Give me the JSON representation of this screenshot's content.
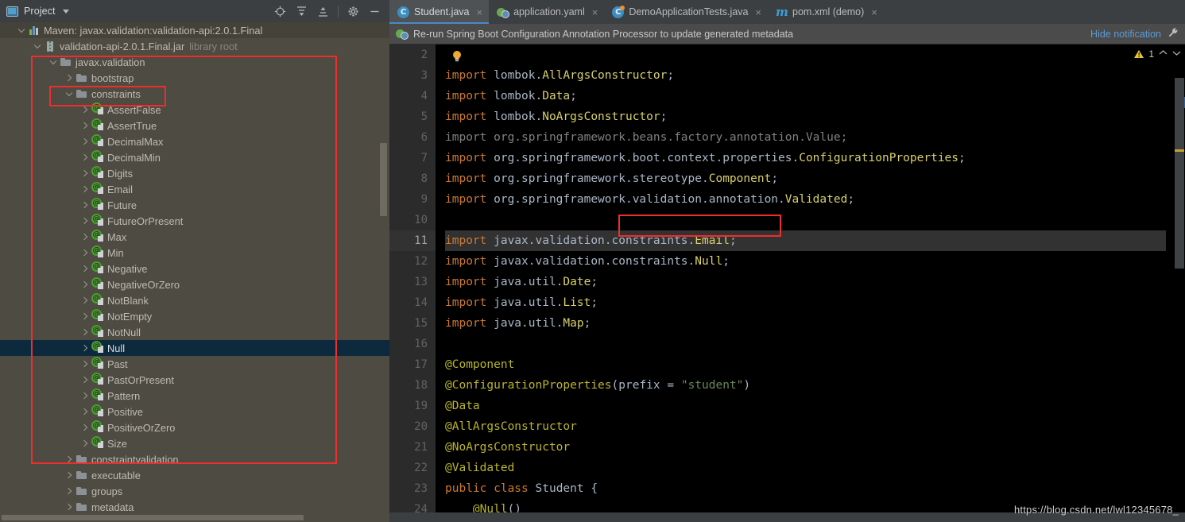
{
  "project_panel": {
    "title": "Project",
    "icons": {
      "locate": "locate-icon",
      "expand_all": "expand-all-icon",
      "collapse_all": "collapse-all-icon",
      "settings": "gear-icon",
      "minimize": "minimize-icon"
    },
    "tree": [
      {
        "label": "Maven: javax.validation:validation-api:2.0.1.Final",
        "suffix": "",
        "indent": 20,
        "icon": "maven-icon",
        "chevron": "open",
        "state": "hover"
      },
      {
        "label": "validation-api-2.0.1.Final.jar",
        "suffix": "library root",
        "indent": 40,
        "icon": "jar-icon",
        "chevron": "open",
        "state": "normal"
      },
      {
        "label": "javax.validation",
        "suffix": "",
        "indent": 60,
        "icon": "folder-icon",
        "chevron": "open",
        "state": "normal"
      },
      {
        "label": "bootstrap",
        "suffix": "",
        "indent": 80,
        "icon": "folder-icon",
        "chevron": "closed",
        "state": "normal"
      },
      {
        "label": "constraints",
        "suffix": "",
        "indent": 80,
        "icon": "folder-icon",
        "chevron": "open",
        "state": "normal"
      },
      {
        "label": "AssertFalse",
        "suffix": "",
        "indent": 100,
        "icon": "annotation-icon",
        "chevron": "closed",
        "state": "normal"
      },
      {
        "label": "AssertTrue",
        "suffix": "",
        "indent": 100,
        "icon": "annotation-icon",
        "chevron": "closed",
        "state": "normal"
      },
      {
        "label": "DecimalMax",
        "suffix": "",
        "indent": 100,
        "icon": "annotation-icon",
        "chevron": "closed",
        "state": "normal"
      },
      {
        "label": "DecimalMin",
        "suffix": "",
        "indent": 100,
        "icon": "annotation-icon",
        "chevron": "closed",
        "state": "normal"
      },
      {
        "label": "Digits",
        "suffix": "",
        "indent": 100,
        "icon": "annotation-icon",
        "chevron": "closed",
        "state": "normal"
      },
      {
        "label": "Email",
        "suffix": "",
        "indent": 100,
        "icon": "annotation-icon",
        "chevron": "closed",
        "state": "normal"
      },
      {
        "label": "Future",
        "suffix": "",
        "indent": 100,
        "icon": "annotation-icon",
        "chevron": "closed",
        "state": "normal"
      },
      {
        "label": "FutureOrPresent",
        "suffix": "",
        "indent": 100,
        "icon": "annotation-icon",
        "chevron": "closed",
        "state": "normal"
      },
      {
        "label": "Max",
        "suffix": "",
        "indent": 100,
        "icon": "annotation-icon",
        "chevron": "closed",
        "state": "normal"
      },
      {
        "label": "Min",
        "suffix": "",
        "indent": 100,
        "icon": "annotation-icon",
        "chevron": "closed",
        "state": "normal"
      },
      {
        "label": "Negative",
        "suffix": "",
        "indent": 100,
        "icon": "annotation-icon",
        "chevron": "closed",
        "state": "normal"
      },
      {
        "label": "NegativeOrZero",
        "suffix": "",
        "indent": 100,
        "icon": "annotation-icon",
        "chevron": "closed",
        "state": "normal"
      },
      {
        "label": "NotBlank",
        "suffix": "",
        "indent": 100,
        "icon": "annotation-icon",
        "chevron": "closed",
        "state": "normal"
      },
      {
        "label": "NotEmpty",
        "suffix": "",
        "indent": 100,
        "icon": "annotation-icon",
        "chevron": "closed",
        "state": "normal"
      },
      {
        "label": "NotNull",
        "suffix": "",
        "indent": 100,
        "icon": "annotation-icon",
        "chevron": "closed",
        "state": "normal"
      },
      {
        "label": "Null",
        "suffix": "",
        "indent": 100,
        "icon": "annotation-icon",
        "chevron": "closed",
        "state": "selected"
      },
      {
        "label": "Past",
        "suffix": "",
        "indent": 100,
        "icon": "annotation-icon",
        "chevron": "closed",
        "state": "normal"
      },
      {
        "label": "PastOrPresent",
        "suffix": "",
        "indent": 100,
        "icon": "annotation-icon",
        "chevron": "closed",
        "state": "normal"
      },
      {
        "label": "Pattern",
        "suffix": "",
        "indent": 100,
        "icon": "annotation-icon",
        "chevron": "closed",
        "state": "normal"
      },
      {
        "label": "Positive",
        "suffix": "",
        "indent": 100,
        "icon": "annotation-icon",
        "chevron": "closed",
        "state": "normal"
      },
      {
        "label": "PositiveOrZero",
        "suffix": "",
        "indent": 100,
        "icon": "annotation-icon",
        "chevron": "closed",
        "state": "normal"
      },
      {
        "label": "Size",
        "suffix": "",
        "indent": 100,
        "icon": "annotation-icon",
        "chevron": "closed",
        "state": "normal"
      },
      {
        "label": "constraintvalidation",
        "suffix": "",
        "indent": 80,
        "icon": "folder-icon",
        "chevron": "closed",
        "state": "normal"
      },
      {
        "label": "executable",
        "suffix": "",
        "indent": 80,
        "icon": "folder-icon",
        "chevron": "closed",
        "state": "normal"
      },
      {
        "label": "groups",
        "suffix": "",
        "indent": 80,
        "icon": "folder-icon",
        "chevron": "closed",
        "state": "normal"
      },
      {
        "label": "metadata",
        "suffix": "",
        "indent": 80,
        "icon": "folder-icon",
        "chevron": "closed",
        "state": "normal"
      }
    ]
  },
  "tabs": [
    {
      "label": "Student.java",
      "icon": "java-class-icon",
      "active": true,
      "close": "×"
    },
    {
      "label": "application.yaml",
      "icon": "spring-yaml-icon",
      "active": false,
      "close": "×"
    },
    {
      "label": "DemoApplicationTests.java",
      "icon": "java-test-class-icon",
      "active": false,
      "close": "×"
    },
    {
      "label": "pom.xml (demo)",
      "icon": "maven-pom-icon",
      "active": false,
      "close": "×"
    }
  ],
  "notification": {
    "icon": "spring-leaf-icon",
    "message": "Re-run Spring Boot Configuration Annotation Processor to update generated metadata",
    "action_label": "Hide notification",
    "wrench_icon": "wrench-icon"
  },
  "inspection": {
    "warning_count": "1",
    "up_arrow": "⌃",
    "down_arrow": "⌄"
  },
  "editor": {
    "first_line": 2,
    "current_line": 11,
    "lines": [
      {
        "n": 2,
        "tokens": []
      },
      {
        "n": 3,
        "fold": "collapse",
        "tokens": [
          {
            "t": "import ",
            "c": "kw"
          },
          {
            "t": "lombok.",
            "c": "pkg"
          },
          {
            "t": "AllArgsConstructor",
            "c": "cls"
          },
          {
            "t": ";",
            "c": "plain"
          }
        ]
      },
      {
        "n": 4,
        "tokens": [
          {
            "t": "import ",
            "c": "kw"
          },
          {
            "t": "lombok.",
            "c": "pkg"
          },
          {
            "t": "Data",
            "c": "cls"
          },
          {
            "t": ";",
            "c": "plain"
          }
        ]
      },
      {
        "n": 5,
        "tokens": [
          {
            "t": "import ",
            "c": "kw"
          },
          {
            "t": "lombok.",
            "c": "pkg"
          },
          {
            "t": "NoArgsConstructor",
            "c": "cls"
          },
          {
            "t": ";",
            "c": "plain"
          }
        ]
      },
      {
        "n": 6,
        "tokens": [
          {
            "t": "import org.springframework.beans.factory.annotation.Value;",
            "c": "unused"
          }
        ]
      },
      {
        "n": 7,
        "tokens": [
          {
            "t": "import ",
            "c": "kw"
          },
          {
            "t": "org.springframework.boot.context.properties.",
            "c": "pkg"
          },
          {
            "t": "ConfigurationProperties",
            "c": "cls"
          },
          {
            "t": ";",
            "c": "plain"
          }
        ]
      },
      {
        "n": 8,
        "tokens": [
          {
            "t": "import ",
            "c": "kw"
          },
          {
            "t": "org.springframework.stereotype.",
            "c": "pkg"
          },
          {
            "t": "Component",
            "c": "cls"
          },
          {
            "t": ";",
            "c": "plain"
          }
        ]
      },
      {
        "n": 9,
        "tokens": [
          {
            "t": "import ",
            "c": "kw"
          },
          {
            "t": "org.springframework.validation.annotation.",
            "c": "pkg"
          },
          {
            "t": "Validated",
            "c": "cls"
          },
          {
            "t": ";",
            "c": "plain"
          }
        ]
      },
      {
        "n": 10,
        "bulb": true,
        "tokens": []
      },
      {
        "n": 11,
        "current": true,
        "tokens": [
          {
            "t": "import ",
            "c": "kw"
          },
          {
            "t": "javax.validation.constraints.",
            "c": "pkg"
          },
          {
            "t": "Email",
            "c": "cls"
          },
          {
            "t": ";",
            "c": "plain"
          }
        ]
      },
      {
        "n": 12,
        "tokens": [
          {
            "t": "import ",
            "c": "kw"
          },
          {
            "t": "javax.validation.constraints.",
            "c": "pkg"
          },
          {
            "t": "Null",
            "c": "cls"
          },
          {
            "t": ";",
            "c": "plain"
          }
        ]
      },
      {
        "n": 13,
        "tokens": [
          {
            "t": "import ",
            "c": "kw"
          },
          {
            "t": "java.util.",
            "c": "pkg"
          },
          {
            "t": "Date",
            "c": "cls"
          },
          {
            "t": ";",
            "c": "plain"
          }
        ]
      },
      {
        "n": 14,
        "tokens": [
          {
            "t": "import ",
            "c": "kw"
          },
          {
            "t": "java.util.",
            "c": "pkg"
          },
          {
            "t": "List",
            "c": "cls"
          },
          {
            "t": ";",
            "c": "plain"
          }
        ]
      },
      {
        "n": 15,
        "fold": "expand",
        "tokens": [
          {
            "t": "import ",
            "c": "kw"
          },
          {
            "t": "java.util.",
            "c": "pkg"
          },
          {
            "t": "Map",
            "c": "cls"
          },
          {
            "t": ";",
            "c": "plain"
          }
        ]
      },
      {
        "n": 16,
        "tokens": []
      },
      {
        "n": 17,
        "fold": "collapse",
        "tokens": [
          {
            "t": "@Component",
            "c": "anno"
          }
        ]
      },
      {
        "n": 18,
        "tokens": [
          {
            "t": "@ConfigurationProperties",
            "c": "anno"
          },
          {
            "t": "(",
            "c": "plain"
          },
          {
            "t": "prefix",
            "c": "pkg"
          },
          {
            "t": " = ",
            "c": "plain"
          },
          {
            "t": "\"student\"",
            "c": "str"
          },
          {
            "t": ")",
            "c": "plain"
          }
        ]
      },
      {
        "n": 19,
        "tokens": [
          {
            "t": "@Data",
            "c": "anno"
          }
        ]
      },
      {
        "n": 20,
        "tokens": [
          {
            "t": "@AllArgsConstructor",
            "c": "anno"
          }
        ]
      },
      {
        "n": 21,
        "tokens": [
          {
            "t": "@NoArgsConstructor",
            "c": "anno"
          }
        ]
      },
      {
        "n": 22,
        "fold": "expand",
        "tokens": [
          {
            "t": "@Validated",
            "c": "anno"
          }
        ]
      },
      {
        "n": 23,
        "bean": true,
        "tokens": [
          {
            "t": "public ",
            "c": "kw"
          },
          {
            "t": "class ",
            "c": "kw"
          },
          {
            "t": "Student",
            "c": "pkg"
          },
          {
            "t": " {",
            "c": "plain"
          }
        ]
      },
      {
        "n": 24,
        "tokens": [
          {
            "t": "    @Null",
            "c": "anno"
          },
          {
            "t": "()",
            "c": "plain"
          }
        ]
      }
    ]
  },
  "watermark": "https://blog.csdn.net/lwl12345678_",
  "colors": {
    "annotation_box": "#ef2d2d",
    "selection": "#0d293e",
    "tab_underline": "#4a88c7",
    "link": "#5b9bd5",
    "panel_bg": "#4e4b42",
    "editor_bg": "#000000"
  }
}
